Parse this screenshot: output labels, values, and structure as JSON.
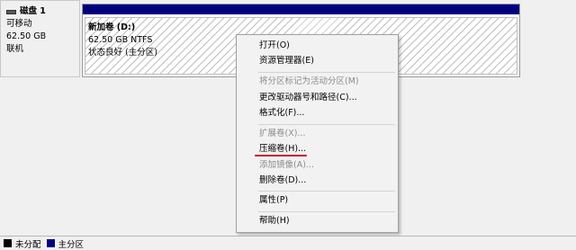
{
  "disk": {
    "title": "磁盘 1",
    "type": "可移动",
    "size": "62.50 GB",
    "status": "联机"
  },
  "partition": {
    "name": "新加卷 (D:)",
    "size_fs": "62.50 GB NTFS",
    "health": "状态良好 (主分区)"
  },
  "menu": {
    "items": [
      {
        "label": "打开(O)",
        "enabled": true
      },
      {
        "label": "资源管理器(E)",
        "enabled": true
      },
      {
        "label": "将分区标记为活动分区(M)",
        "enabled": false
      },
      {
        "label": "更改驱动器号和路径(C)...",
        "enabled": true
      },
      {
        "label": "格式化(F)...",
        "enabled": true
      },
      {
        "label": "扩展卷(X)...",
        "enabled": false
      },
      {
        "label": "压缩卷(H)...",
        "enabled": true
      },
      {
        "label": "添加镜像(A)...",
        "enabled": false
      },
      {
        "label": "删除卷(D)...",
        "enabled": true
      },
      {
        "label": "属性(P)",
        "enabled": true
      },
      {
        "label": "帮助(H)",
        "enabled": true
      }
    ]
  },
  "legend": {
    "unallocated": "未分配",
    "primary": "主分区"
  },
  "colors": {
    "primary_partition": "#00007f",
    "highlight_underline": "#c8102e"
  }
}
